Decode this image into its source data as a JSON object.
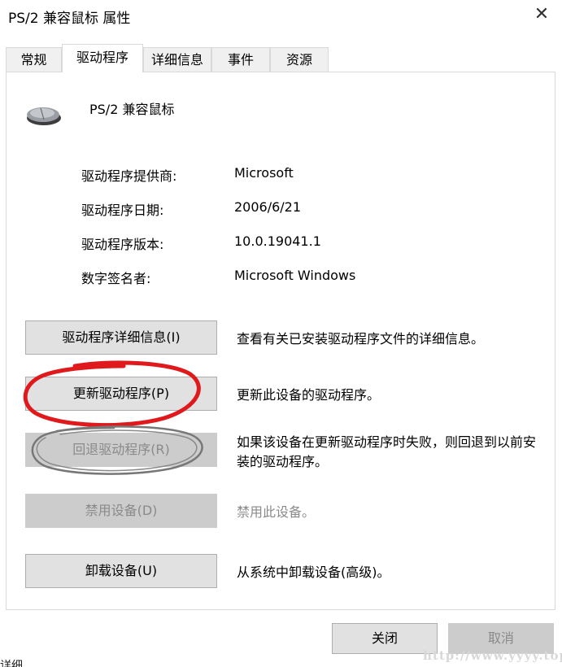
{
  "window": {
    "title": "PS/2 兼容鼠标 属性"
  },
  "tabs": [
    "常规",
    "驱动程序",
    "详细信息",
    "事件",
    "资源"
  ],
  "device": {
    "name": "PS/2 兼容鼠标",
    "icon": "mouse-icon"
  },
  "info": {
    "provider_label": "驱动程序提供商:",
    "provider_value": "Microsoft",
    "date_label": "驱动程序日期:",
    "date_value": "2006/6/21",
    "version_label": "驱动程序版本:",
    "version_value": "10.0.19041.1",
    "signer_label": "数字签名者:",
    "signer_value": "Microsoft Windows"
  },
  "actions": {
    "details_button": "驱动程序详细信息(I)",
    "details_desc": "查看有关已安装驱动程序文件的详细信息。",
    "update_button": "更新驱动程序(P)",
    "update_desc": "更新此设备的驱动程序。",
    "rollback_button": "回退驱动程序(R)",
    "rollback_desc": "如果该设备在更新驱动程序时失败，则回退到以前安装的驱动程序。",
    "disable_button": "禁用设备(D)",
    "disable_desc": "禁用此设备。",
    "uninstall_button": "卸载设备(U)",
    "uninstall_desc": "从系统中卸载设备(高级)。"
  },
  "footer": {
    "ok_label": "关闭",
    "cancel_label": "取消"
  },
  "watermark": "http://www.yyyy.top",
  "background_text": "详细",
  "colors": {
    "annotation_red": "#e0191c",
    "annotation_gray": "#777777",
    "disabled_bg": "#cccccc"
  }
}
